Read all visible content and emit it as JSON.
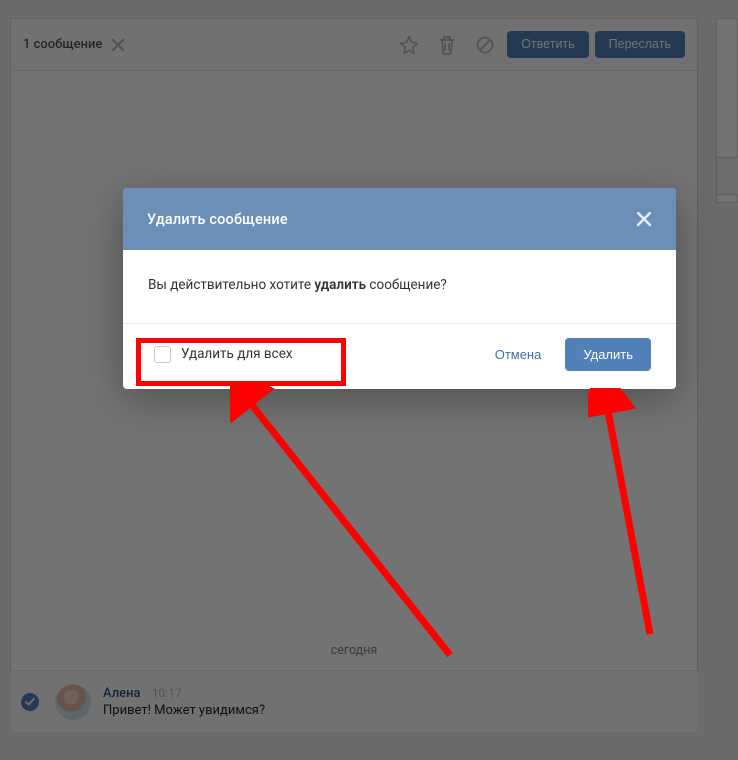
{
  "toolbar": {
    "selection_count": "1 сообщение",
    "reply_label": "Ответить",
    "forward_label": "Переслать"
  },
  "chat": {
    "date_separator": "сегодня",
    "message": {
      "sender": "Алена",
      "time": "10:17",
      "text": "Привет! Может увидимся?"
    }
  },
  "dialog": {
    "title": "Удалить сообщение",
    "confirm_prefix": "Вы действительно хотите ",
    "confirm_bold": "удалить",
    "confirm_suffix": " сообщение?",
    "delete_for_all_label": "Удалить для всех",
    "cancel_label": "Отмена",
    "delete_label": "Удалить"
  },
  "annotation": {
    "highlight_color": "#ff0000"
  }
}
